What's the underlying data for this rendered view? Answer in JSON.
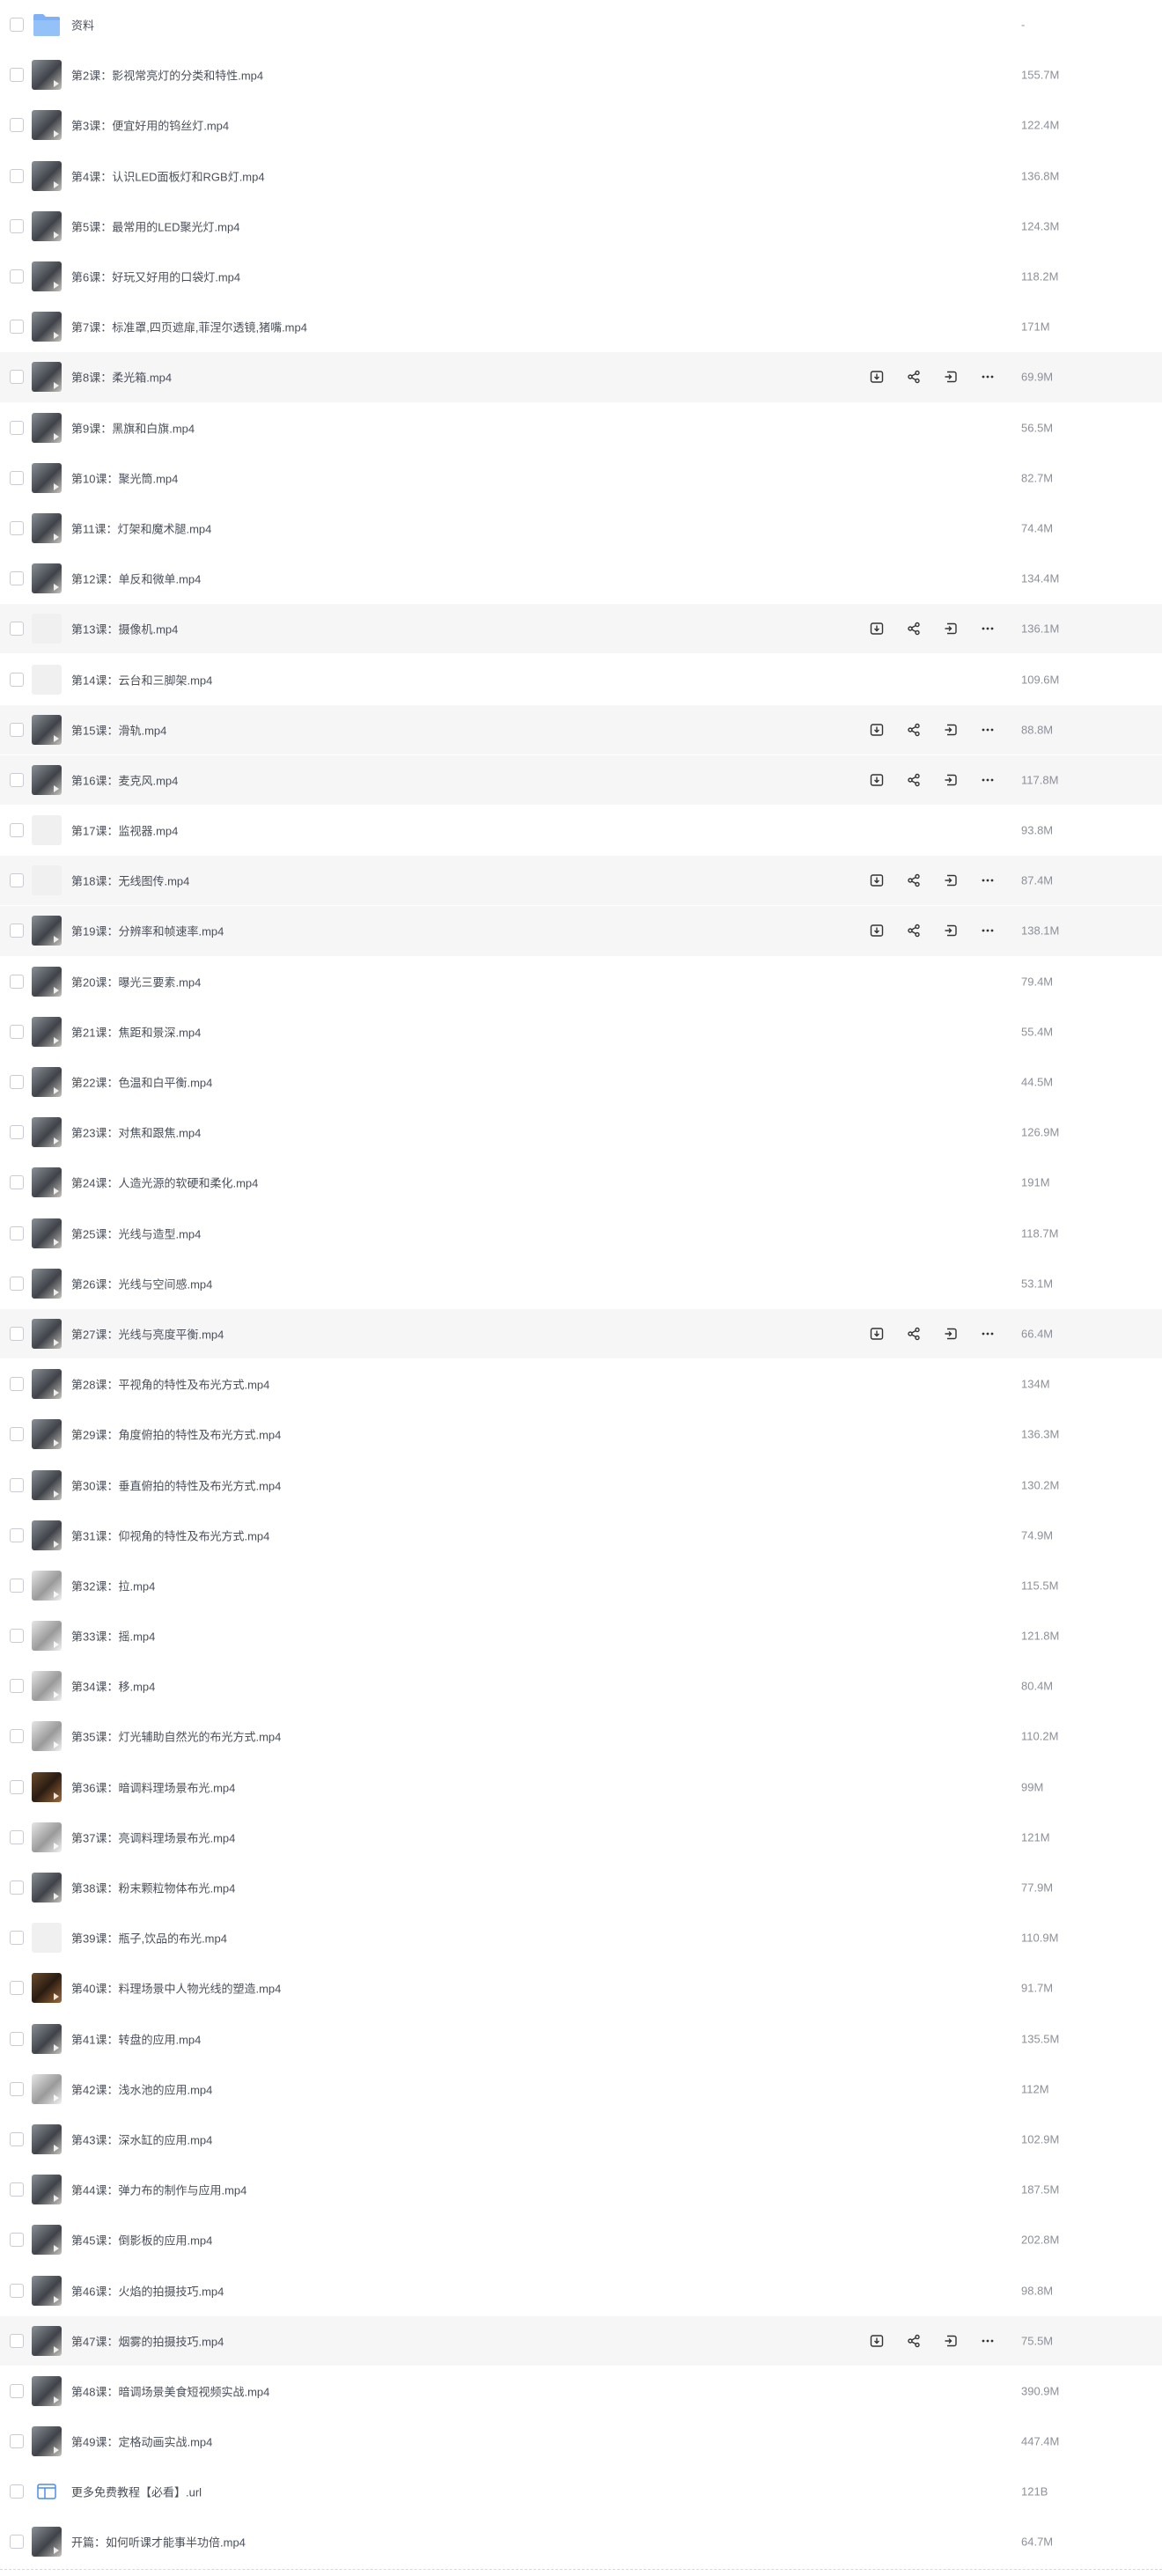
{
  "files": [
    {
      "name": "资料",
      "size": "-",
      "kind": "folder"
    },
    {
      "name": "第2课：影视常亮灯的分类和特性.mp4",
      "size": "155.7M",
      "kind": "video"
    },
    {
      "name": "第3课：便宜好用的钨丝灯.mp4",
      "size": "122.4M",
      "kind": "video"
    },
    {
      "name": "第4课：认识LED面板灯和RGB灯.mp4",
      "size": "136.8M",
      "kind": "video"
    },
    {
      "name": "第5课：最常用的LED聚光灯.mp4",
      "size": "124.3M",
      "kind": "video"
    },
    {
      "name": "第6课：好玩又好用的口袋灯.mp4",
      "size": "118.2M",
      "kind": "video"
    },
    {
      "name": "第7课：标准罩,四页遮扉,菲涅尔透镜,猪嘴.mp4",
      "size": "171M",
      "kind": "video"
    },
    {
      "name": "第8课：柔光箱.mp4",
      "size": "69.9M",
      "kind": "video",
      "hover": true
    },
    {
      "name": "第9课：黑旗和白旗.mp4",
      "size": "56.5M",
      "kind": "video"
    },
    {
      "name": "第10课：聚光筒.mp4",
      "size": "82.7M",
      "kind": "video"
    },
    {
      "name": "第11课：灯架和魔术腿.mp4",
      "size": "74.4M",
      "kind": "video"
    },
    {
      "name": "第12课：单反和微单.mp4",
      "size": "134.4M",
      "kind": "video"
    },
    {
      "name": "第13课：摄像机.mp4",
      "size": "136.1M",
      "kind": "blank",
      "hover": true
    },
    {
      "name": "第14课：云台和三脚架.mp4",
      "size": "109.6M",
      "kind": "blank"
    },
    {
      "name": "第15课：滑轨.mp4",
      "size": "88.8M",
      "kind": "video",
      "hover": true
    },
    {
      "name": "第16课：麦克风.mp4",
      "size": "117.8M",
      "kind": "video",
      "hover": true
    },
    {
      "name": "第17课：监视器.mp4",
      "size": "93.8M",
      "kind": "blank"
    },
    {
      "name": "第18课：无线图传.mp4",
      "size": "87.4M",
      "kind": "blank",
      "hover": true
    },
    {
      "name": "第19课：分辨率和帧速率.mp4",
      "size": "138.1M",
      "kind": "video",
      "hover": true
    },
    {
      "name": "第20课：曝光三要素.mp4",
      "size": "79.4M",
      "kind": "video"
    },
    {
      "name": "第21课：焦距和景深.mp4",
      "size": "55.4M",
      "kind": "video"
    },
    {
      "name": "第22课：色温和白平衡.mp4",
      "size": "44.5M",
      "kind": "video"
    },
    {
      "name": "第23课：对焦和跟焦.mp4",
      "size": "126.9M",
      "kind": "video"
    },
    {
      "name": "第24课：人造光源的软硬和柔化.mp4",
      "size": "191M",
      "kind": "video"
    },
    {
      "name": "第25课：光线与造型.mp4",
      "size": "118.7M",
      "kind": "video"
    },
    {
      "name": "第26课：光线与空间感.mp4",
      "size": "53.1M",
      "kind": "video"
    },
    {
      "name": "第27课：光线与亮度平衡.mp4",
      "size": "66.4M",
      "kind": "video",
      "hover": true
    },
    {
      "name": "第28课：平视角的特性及布光方式.mp4",
      "size": "134M",
      "kind": "video"
    },
    {
      "name": "第29课：角度俯拍的特性及布光方式.mp4",
      "size": "136.3M",
      "kind": "video"
    },
    {
      "name": "第30课：垂直俯拍的特性及布光方式.mp4",
      "size": "130.2M",
      "kind": "video"
    },
    {
      "name": "第31课：仰视角的特性及布光方式.mp4",
      "size": "74.9M",
      "kind": "video"
    },
    {
      "name": "第32课：拉.mp4",
      "size": "115.5M",
      "kind": "video-light"
    },
    {
      "name": "第33课：摇.mp4",
      "size": "121.8M",
      "kind": "video-light"
    },
    {
      "name": "第34课：移.mp4",
      "size": "80.4M",
      "kind": "video-light"
    },
    {
      "name": "第35课：灯光辅助自然光的布光方式.mp4",
      "size": "110.2M",
      "kind": "video-light"
    },
    {
      "name": "第36课：暗调料理场景布光.mp4",
      "size": "99M",
      "kind": "video-dark"
    },
    {
      "name": "第37课：亮调料理场景布光.mp4",
      "size": "121M",
      "kind": "video-light"
    },
    {
      "name": "第38课：粉末颗粒物体布光.mp4",
      "size": "77.9M",
      "kind": "video"
    },
    {
      "name": "第39课：瓶子,饮品的布光.mp4",
      "size": "110.9M",
      "kind": "blank"
    },
    {
      "name": "第40课：料理场景中人物光线的塑造.mp4",
      "size": "91.7M",
      "kind": "video-dark"
    },
    {
      "name": "第41课：转盘的应用.mp4",
      "size": "135.5M",
      "kind": "video"
    },
    {
      "name": "第42课：浅水池的应用.mp4",
      "size": "112M",
      "kind": "video-light"
    },
    {
      "name": "第43课：深水缸的应用.mp4",
      "size": "102.9M",
      "kind": "video"
    },
    {
      "name": "第44课：弹力布的制作与应用.mp4",
      "size": "187.5M",
      "kind": "video"
    },
    {
      "name": "第45课：倒影板的应用.mp4",
      "size": "202.8M",
      "kind": "video"
    },
    {
      "name": "第46课：火焰的拍摄技巧.mp4",
      "size": "98.8M",
      "kind": "video"
    },
    {
      "name": "第47课：烟雾的拍摄技巧.mp4",
      "size": "75.5M",
      "kind": "video",
      "hover": true
    },
    {
      "name": "第48课：暗调场景美食短视频实战.mp4",
      "size": "390.9M",
      "kind": "video"
    },
    {
      "name": "第49课：定格动画实战.mp4",
      "size": "447.4M",
      "kind": "video"
    },
    {
      "name": "更多免费教程【必看】.url",
      "size": "121B",
      "kind": "link"
    },
    {
      "name": "开篇：如何听课才能事半功倍.mp4",
      "size": "64.7M",
      "kind": "video"
    }
  ],
  "actions": [
    {
      "name": "download-icon"
    },
    {
      "name": "share-icon"
    },
    {
      "name": "move-icon"
    },
    {
      "name": "more-icon"
    }
  ],
  "colors": {
    "hover_row": "#f6f6f7",
    "text": "#4a4f5a",
    "muted": "#8c9099",
    "folder": "#7fb1f4"
  }
}
